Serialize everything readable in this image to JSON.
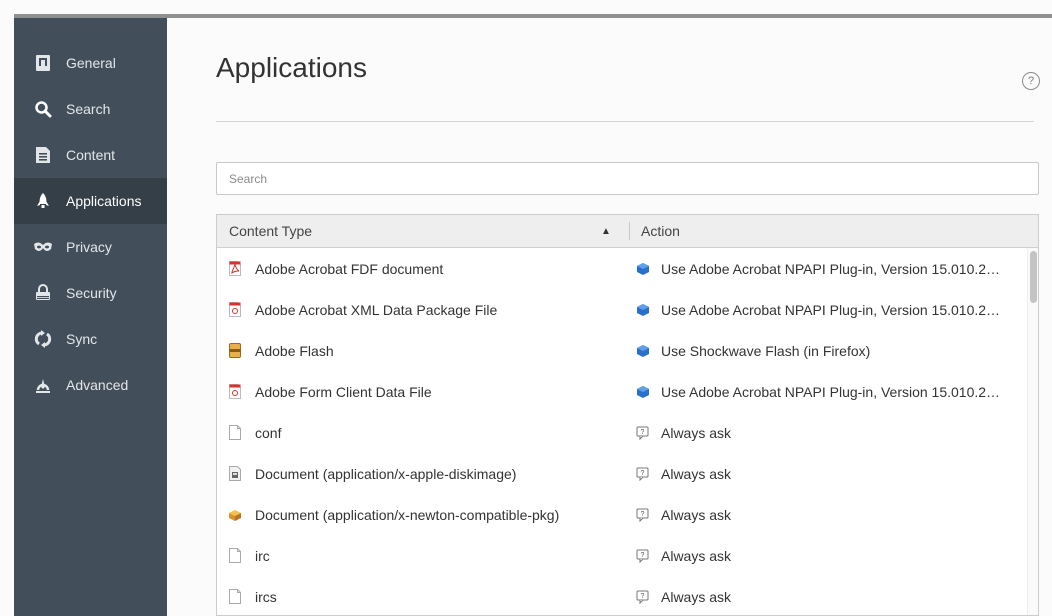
{
  "sidebar": {
    "items": [
      {
        "label": "General",
        "icon": "general-icon"
      },
      {
        "label": "Search",
        "icon": "search-icon"
      },
      {
        "label": "Content",
        "icon": "content-icon"
      },
      {
        "label": "Applications",
        "icon": "applications-icon",
        "active": true
      },
      {
        "label": "Privacy",
        "icon": "privacy-icon"
      },
      {
        "label": "Security",
        "icon": "security-icon"
      },
      {
        "label": "Sync",
        "icon": "sync-icon"
      },
      {
        "label": "Advanced",
        "icon": "advanced-icon"
      }
    ]
  },
  "main": {
    "title": "Applications",
    "help_icon": "?",
    "search_placeholder": "Search",
    "table": {
      "headers": {
        "content_type": "Content Type",
        "action": "Action"
      },
      "sort_indicator": "▲",
      "rows": [
        {
          "content_type": "Adobe Acrobat FDF document",
          "type_icon": "pdf-file-icon",
          "action": "Use Adobe Acrobat NPAPI Plug-in, Version 15.010.2…",
          "action_icon": "plugin-icon"
        },
        {
          "content_type": "Adobe Acrobat XML Data Package File",
          "type_icon": "pdf-file-icon",
          "action": "Use Adobe Acrobat NPAPI Plug-in, Version 15.010.2…",
          "action_icon": "plugin-icon"
        },
        {
          "content_type": "Adobe Flash",
          "type_icon": "flash-file-icon",
          "action": "Use Shockwave Flash (in Firefox)",
          "action_icon": "plugin-icon"
        },
        {
          "content_type": "Adobe Form Client Data File",
          "type_icon": "pdf-file-icon",
          "action": "Use Adobe Acrobat NPAPI Plug-in, Version 15.010.2…",
          "action_icon": "plugin-icon"
        },
        {
          "content_type": "conf",
          "type_icon": "blank-file-icon",
          "action": "Always ask",
          "action_icon": "ask-icon"
        },
        {
          "content_type": "Document (application/x-apple-diskimage)",
          "type_icon": "disk-image-icon",
          "action": "Always ask",
          "action_icon": "ask-icon"
        },
        {
          "content_type": "Document (application/x-newton-compatible-pkg)",
          "type_icon": "package-icon",
          "action": "Always ask",
          "action_icon": "ask-icon"
        },
        {
          "content_type": "irc",
          "type_icon": "blank-file-icon",
          "action": "Always ask",
          "action_icon": "ask-icon"
        },
        {
          "content_type": "ircs",
          "type_icon": "blank-file-icon",
          "action": "Always ask",
          "action_icon": "ask-icon"
        }
      ]
    }
  }
}
